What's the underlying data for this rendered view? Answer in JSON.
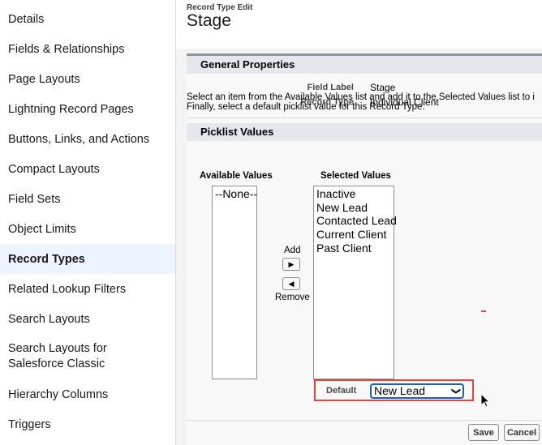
{
  "sidebar": {
    "items": [
      {
        "label": "Details"
      },
      {
        "label": "Fields & Relationships"
      },
      {
        "label": "Page Layouts"
      },
      {
        "label": "Lightning Record Pages"
      },
      {
        "label": "Buttons, Links, and Actions"
      },
      {
        "label": "Compact Layouts"
      },
      {
        "label": "Field Sets"
      },
      {
        "label": "Object Limits"
      },
      {
        "label": "Record Types"
      },
      {
        "label": "Related Lookup Filters"
      },
      {
        "label": "Search Layouts"
      },
      {
        "label": "Search Layouts for Salesforce Classic"
      },
      {
        "label": "Hierarchy Columns"
      },
      {
        "label": "Triggers"
      }
    ],
    "active_label": "Record Types"
  },
  "header": {
    "breadcrumb": "Record Type Edit",
    "title": "Stage"
  },
  "general": {
    "section_title": "General Properties",
    "field_label_label": "Field Label",
    "field_label_value": "Stage",
    "record_type_label": "Record Type",
    "record_type_value": "Individual Client"
  },
  "picklist": {
    "section_title": "Picklist Values",
    "description_line1": "Select an item from the Available Values list and add it to the Selected Values list to i",
    "description_line2": "Finally, select a default picklist value for this Record Type.",
    "available_header": "Available Values",
    "selected_header": "Selected Values",
    "available_values": [
      "--None--"
    ],
    "selected_values": [
      "Inactive",
      "New Lead",
      "Contacted Lead",
      "Current Client",
      "Past Client"
    ],
    "add_label": "Add",
    "remove_label": "Remove",
    "default_label": "Default",
    "default_value": "New Lead"
  },
  "footer": {
    "save_label": "Save",
    "cancel_label": "Cancel"
  },
  "colors": {
    "accent": "#1b5fc1",
    "highlight_border": "#e0473f",
    "active_nav_bg": "#eef4ff"
  }
}
